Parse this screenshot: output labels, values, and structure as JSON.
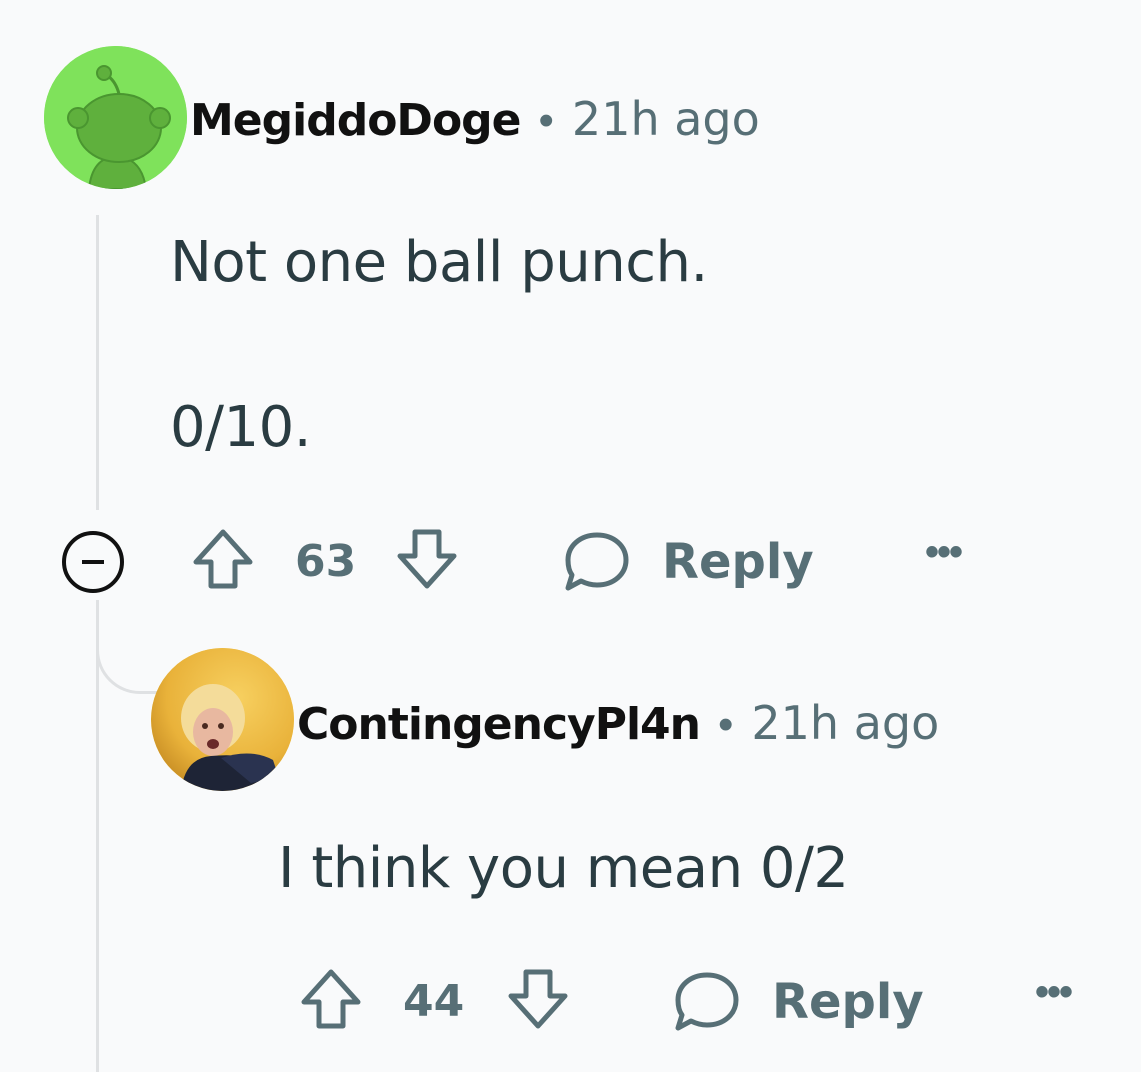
{
  "comments": [
    {
      "username": "MegiddoDoge",
      "separator": "•",
      "time": "21h ago",
      "body": [
        "Not one ball punch.",
        "0/10."
      ],
      "votes": "63",
      "reply_label": "Reply",
      "more": "•••",
      "avatar_icon": "reddit-snoo-avatar",
      "avatar_color": "#7fe25b"
    },
    {
      "username": "ContingencyPl4n",
      "separator": "•",
      "time": "21h ago",
      "body": [
        "I think you mean 0/2"
      ],
      "votes": "44",
      "reply_label": "Reply",
      "more": "•••",
      "avatar_icon": "user-photo-avatar"
    }
  ],
  "colors": {
    "background": "#f9fafb",
    "meta": "#576f76",
    "text": "#2a3c42",
    "username": "#111111",
    "thread_line": "#dfe1e3"
  }
}
